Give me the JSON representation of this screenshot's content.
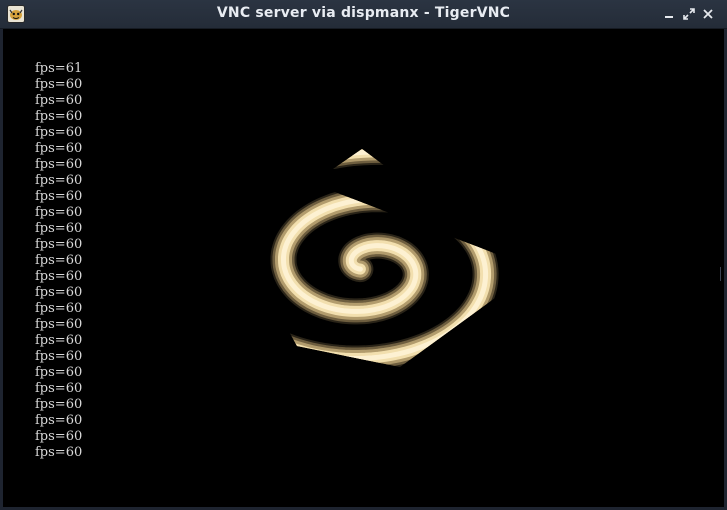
{
  "window": {
    "title": "VNC server via dispmanx - TigerVNC",
    "icons": {
      "app": "tigervnc-app-icon",
      "minimize": "minimize-icon",
      "restore": "restore-icon",
      "close": "close-icon"
    }
  },
  "content": {
    "fps_lines": [
      "fps=61",
      "fps=60",
      "fps=60",
      "fps=60",
      "fps=60",
      "fps=60",
      "fps=60",
      "fps=60",
      "fps=60",
      "fps=60",
      "fps=60",
      "fps=60",
      "fps=60",
      "fps=60",
      "fps=60",
      "fps=60",
      "fps=60",
      "fps=60",
      "fps=60",
      "fps=60",
      "fps=60",
      "fps=60",
      "fps=60",
      "fps=60",
      "fps=60"
    ],
    "spiral_color": "#f2dfae",
    "background_color": "#000000"
  }
}
